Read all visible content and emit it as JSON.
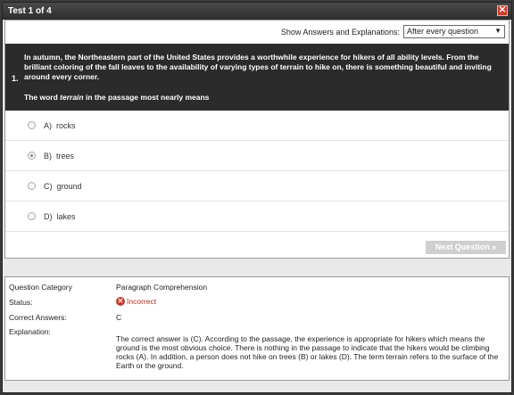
{
  "window": {
    "title": "Test 1 of 4",
    "close_glyph": "✕"
  },
  "settings": {
    "show_label": "Show Answers and Explanations:",
    "show_value": "After every question"
  },
  "question": {
    "number": "1.",
    "text": "In autumn, the Northeastern part of the United States provides a worthwhile experience for hikers of all ability levels.  From the brilliant coloring of the fall leaves to the availability of varying types of terrain to hike on, there is something beautiful and inviting around every corner.",
    "prompt_pre": "The word ",
    "prompt_word": "terrain",
    "prompt_post": " in the passage most nearly means"
  },
  "options": [
    {
      "letter": "A)",
      "text": "rocks",
      "selected": false
    },
    {
      "letter": "B)",
      "text": "trees",
      "selected": true
    },
    {
      "letter": "C)",
      "text": "ground",
      "selected": false
    },
    {
      "letter": "D)",
      "text": "lakes",
      "selected": false
    }
  ],
  "next_button": "Next Question »",
  "details": {
    "category_label": "Question Category",
    "category_value": "Paragraph Comprehension",
    "status_label": "Status:",
    "status_value": "Incorrect",
    "correct_label": "Correct Answers:",
    "correct_value": "C",
    "explanation_label": "Explanation:",
    "explanation_text": "The correct answer is (C). According to the passage, the experience is appropriate for hikers which means the ground is the most obvious choice.  There is nothing in the passage to indicate that the hikers would be climbing rocks (A).  In addition, a person does not hike on trees (B) or lakes (D).  The term terrain refers to the surface of the Earth or the ground."
  },
  "colors": {
    "status_incorrect": "#b03020",
    "close_button": "#d23a2a",
    "question_bg": "#2b2b2b"
  },
  "icons": {
    "close": "close-icon",
    "status": "incorrect-icon",
    "select": "chevron-down-icon"
  }
}
